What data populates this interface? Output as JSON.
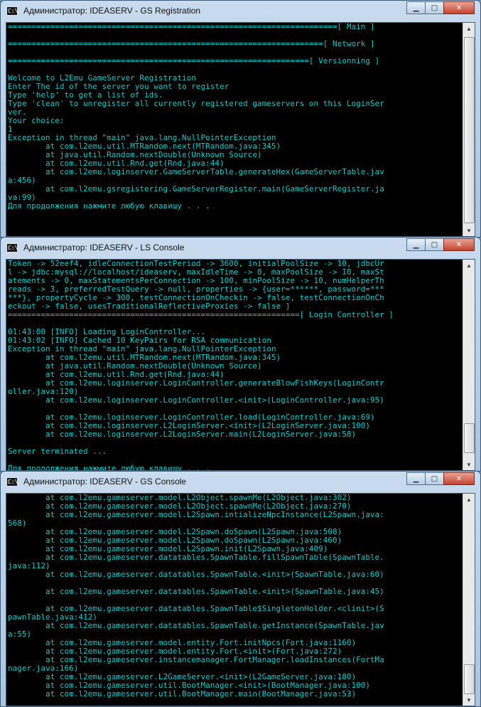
{
  "window1": {
    "title": "Администратор:  IDEASERV - GS Registration",
    "icon_text": "C:\\",
    "lines": [
      "======================================================================[ Main ]",
      "",
      "===================================================================[ Network ]",
      "",
      "================================================================[ Versionning ]",
      "",
      "Welcome to L2Emu GameServer Registration",
      "Enter The id of the server you want to register",
      "Type 'help' to get a list of ids.",
      "Type 'clean' to unregister all currently registered gameservers on this LoginSer",
      "ver.",
      "Your choice:",
      "1",
      "Exception in thread \"main\" java.lang.NullPointerException",
      "        at com.l2emu.util.MTRandom.next(MTRandom.java:345)",
      "        at java.util.Random.nextDouble(Unknown Source)",
      "        at com.l2emu.util.Rnd.get(Rnd.java:44)",
      "        at com.l2emu.loginserver.GameServerTable.generateHex(GameServerTable.jav",
      "a:456)",
      "        at com.l2emu.gsregistering.GameServerRegister.main(GameServerRegister.ja",
      "va:99)",
      "Для продолжения нажмите любую клавишу . . ."
    ]
  },
  "window2": {
    "title": "Администратор:  IDEASERV - LS Console",
    "icon_text": "C:\\",
    "lines": [
      "Token -> 52eef4, idleConnectionTestPeriod -> 3600, initialPoolSize -> 10, jdbcUr",
      "l -> jdbc:mysql://localhost/ideaserv, maxIdleTime -> 0, maxPoolSize -> 10, maxSt",
      "atements -> 0, maxStatementsPerConnection -> 100, minPoolSize -> 10, numHelperTh",
      "reads -> 3, preferredTestQuery -> null, properties -> {user=******, password=***",
      "***}, propertyCycle -> 300, testConnectionOnCheckin -> false, testConnectionOnCh",
      "eckout -> false, usesTraditionalReflectiveProxies -> false ]",
      "==============================================================[ Login Controller ]",
      "",
      "01:43:00 [INFO] Loading LoginController...",
      "01:43:02 [INFO] Cached 10 KeyPairs for RSA communication",
      "Exception in thread \"main\" java.lang.NullPointerException",
      "        at com.l2emu.util.MTRandom.next(MTRandom.java:345)",
      "        at java.util.Random.nextDouble(Unknown Source)",
      "        at com.l2emu.util.Rnd.get(Rnd.java:44)",
      "        at com.l2emu.loginserver.LoginController.generateBlowFishKeys(LoginContr",
      "oller.java:120)",
      "        at com.l2emu.loginserver.LoginController.<init>(LoginController.java:95)",
      "",
      "        at com.l2emu.loginserver.LoginController.load(LoginController.java:69)",
      "        at com.l2emu.loginserver.L2LoginServer.<init>(L2LoginServer.java:100)",
      "        at com.l2emu.loginserver.L2LoginServer.main(L2LoginServer.java:58)",
      "",
      "Server terminated ...",
      "",
      "Для продолжения нажмите любую клавишу . . ."
    ]
  },
  "window3": {
    "title": "Администратор:  IDEASERV - GS Console",
    "icon_text": "C:\\",
    "lines": [
      "        at com.l2emu.gameserver.model.L2Object.spawnMe(L2Object.java:302)",
      "        at com.l2emu.gameserver.model.L2Object.spawnMe(L2Object.java:270)",
      "        at com.l2emu.gameserver.model.L2Spawn.intializeNpcInstance(L2Spawn.java:",
      "568)",
      "        at com.l2emu.gameserver.model.L2Spawn.doSpawn(L2Spawn.java:508)",
      "        at com.l2emu.gameserver.model.L2Spawn.doSpawn(L2Spawn.java:460)",
      "        at com.l2emu.gameserver.model.L2Spawn.init(L2Spawn.java:409)",
      "        at com.l2emu.gameserver.datatables.SpawnTable.fillSpawnTable(SpawnTable.",
      "java:112)",
      "        at com.l2emu.gameserver.datatables.SpawnTable.<init>(SpawnTable.java:60)",
      "",
      "        at com.l2emu.gameserver.datatables.SpawnTable.<init>(SpawnTable.java:45)",
      "",
      "        at com.l2emu.gameserver.datatables.SpawnTable$SingletonHolder.<clinit>(S",
      "pawnTable.java:412)",
      "        at com.l2emu.gameserver.datatables.SpawnTable.getInstance(SpawnTable.jav",
      "a:55)",
      "        at com.l2emu.gameserver.model.entity.Fort.initNpcs(Fort.java:1160)",
      "        at com.l2emu.gameserver.model.entity.Fort.<init>(Fort.java:272)",
      "        at com.l2emu.gameserver.instancemanager.FortManager.loadInstances(FortMa",
      "nager.java:166)",
      "        at com.l2emu.gameserver.L2GameServer.<init>(L2GameServer.java:180)",
      "        at com.l2emu.gameserver.util.BootManager.<init>(BootManager.java:100)",
      "        at com.l2emu.gameserver.util.BootManager.main(BootManager.java:53)"
    ]
  },
  "controls": {
    "minimize_symbol": "▁",
    "maximize_symbol": "□",
    "close_symbol": "✕",
    "scroll_up_symbol": "▲",
    "scroll_down_symbol": "▼"
  }
}
